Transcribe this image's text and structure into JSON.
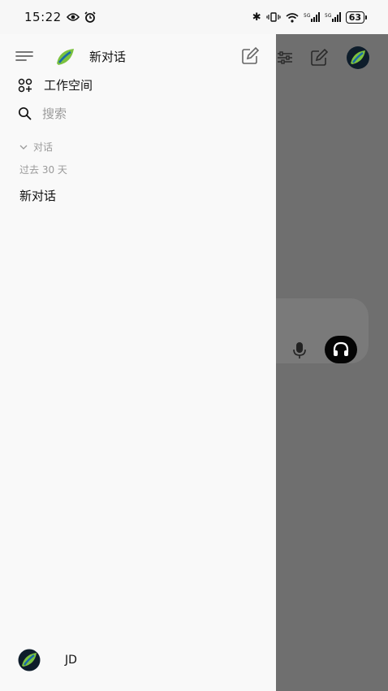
{
  "status_bar": {
    "time": "15:22",
    "battery": "63"
  },
  "drawer": {
    "header": {
      "title": "新对话"
    },
    "workspace_label": "工作空间",
    "search_placeholder": "搜索",
    "section_label": "对话",
    "period_label": "过去 30 天",
    "conversations": [
      {
        "title": "新对话"
      }
    ],
    "profile": {
      "name": "JD"
    }
  },
  "icons": {
    "menu": "hamburger-menu-icon",
    "logo": "leaf-logo-icon",
    "compose": "compose-edit-icon",
    "workspace": "workspace-grid-icon",
    "search": "search-icon",
    "chevron": "chevron-down-icon",
    "microphone": "microphone-icon",
    "headset": "headset-icon"
  },
  "colors": {
    "drawer_background": "#f9f9f9",
    "overlay": "#6f6f6f",
    "muted_text": "#9a9a9a"
  }
}
